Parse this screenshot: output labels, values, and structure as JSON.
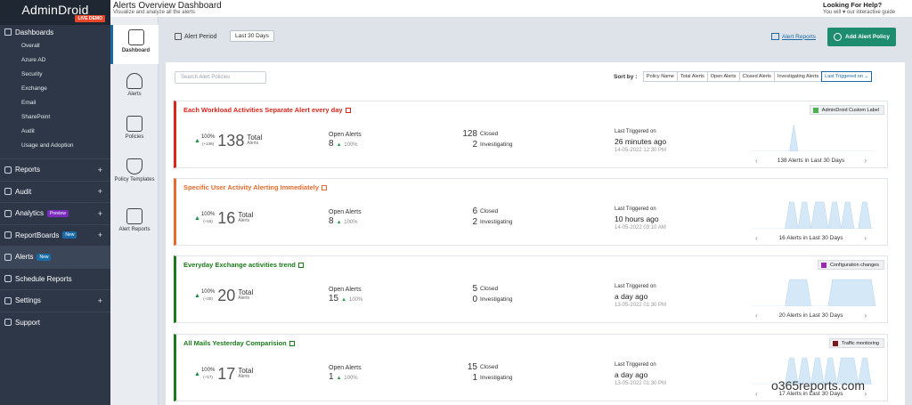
{
  "brand": {
    "name": "AdminDroid",
    "demo": "LIVE DEMO"
  },
  "nav": {
    "dashboards": "Dashboards",
    "sub_items": [
      "Overall",
      "Azure AD",
      "Security",
      "Exchange",
      "Email",
      "SharePoint",
      "Audit",
      "Usage and Adoption"
    ],
    "main_items": [
      {
        "label": "Reports",
        "plus": "+"
      },
      {
        "label": "Audit",
        "plus": "+"
      },
      {
        "label": "Analytics",
        "badge": "Preview",
        "plus": "+"
      },
      {
        "label": "ReportBoards",
        "badge": "New",
        "plus": "+"
      },
      {
        "label": "Alerts",
        "badge": "New"
      },
      {
        "label": "Schedule Reports"
      },
      {
        "label": "Settings",
        "plus": "+"
      },
      {
        "label": "Support"
      }
    ]
  },
  "col2": {
    "items": [
      "Dashboard",
      "Alerts",
      "Policies",
      "Policy Templates",
      "Alert Reports"
    ]
  },
  "header": {
    "title": "Alerts Overview Dashboard",
    "subtitle": "Visualize and analyze all the alerts",
    "help_title": "Looking For Help?",
    "help_sub": "You will ♥ our interactive guide"
  },
  "toolbar": {
    "period_label": "Alert Period",
    "period_value": "Last 30 Days",
    "alert_reports": "Alert Reports",
    "add_policy": "Add Alert Policy"
  },
  "panel": {
    "search_placeholder": "Search Alert Policies",
    "sort_label": "Sort by :",
    "sort_options": [
      "Policy Name",
      "Total Alerts",
      "Open Alerts",
      "Closed Alerts",
      "Investigating Alerts",
      "Last Triggered on ⌄"
    ]
  },
  "labels": {
    "total": "Total",
    "alerts": "Alerts",
    "open_alerts": "Open Alerts",
    "closed": "Closed",
    "investigating": "Investigating",
    "last_triggered": "Last Triggered on"
  },
  "cards": [
    {
      "title": "Each Workload Activities Separate Alert every day",
      "title_color": "#d9261c",
      "tag": "AdminDroid Custom Label",
      "tag_color": "#4caf50",
      "pct": "100%",
      "delta": "(+138)",
      "total": "138",
      "open": "8",
      "open_pct": "100%",
      "closed": "128",
      "investigating": "2",
      "last_rel": "26 minutes ago",
      "last_date": "14-05-2022 12:30 PM",
      "pager": "138 Alerts in Last 30 Days",
      "spark": [
        0,
        0,
        0,
        0,
        0,
        0,
        0,
        0,
        0,
        0,
        1,
        0,
        0,
        0,
        0,
        0,
        0,
        0,
        0,
        0,
        0,
        0,
        0,
        0,
        0,
        0,
        0,
        0,
        0,
        0
      ]
    },
    {
      "title": "Specific User Activity Alerting Immediately",
      "title_color": "#e8692b",
      "tag": "",
      "tag_color": "",
      "pct": "100%",
      "delta": "(+16)",
      "total": "16",
      "open": "8",
      "open_pct": "100%",
      "closed": "6",
      "investigating": "2",
      "last_rel": "10 hours ago",
      "last_date": "14-05-2022 03:10 AM",
      "pager": "16 Alerts in Last 30 Days",
      "spark": [
        0,
        0,
        0,
        0,
        0,
        0,
        0,
        0,
        0,
        1,
        1,
        0,
        1,
        1,
        0,
        1,
        1,
        1,
        0,
        1,
        1,
        0,
        1,
        1,
        0,
        0,
        1,
        1,
        0,
        0
      ]
    },
    {
      "title": "Everyday Exchange activities trend",
      "title_color": "#1a7a1a",
      "tag": "Configuration changes",
      "tag_color": "#9c27b0",
      "pct": "100%",
      "delta": "(+20)",
      "total": "20",
      "open": "15",
      "open_pct": "100%",
      "closed": "5",
      "investigating": "0",
      "last_rel": "a day ago",
      "last_date": "13-05-2022 01:30 PM",
      "pager": "20 Alerts in Last 30 Days",
      "spark": [
        0,
        0,
        0,
        0,
        0,
        0,
        0,
        0,
        0,
        1,
        1,
        1,
        1,
        1,
        0,
        0,
        0,
        0,
        0,
        1,
        1,
        1,
        1,
        1,
        1,
        1,
        1,
        1,
        1,
        0
      ]
    },
    {
      "title": "All Mails Yesterday Comparision",
      "title_color": "#1a7a1a",
      "tag": "Traffic monitoring",
      "tag_color": "#7a1a1a",
      "pct": "100%",
      "delta": "(+17)",
      "total": "17",
      "open": "1",
      "open_pct": "100%",
      "closed": "15",
      "investigating": "1",
      "last_rel": "a day ago",
      "last_date": "13-05-2022 01:30 PM",
      "pager": "17 Alerts in Last 30 Days",
      "spark": [
        0,
        0,
        0,
        0,
        0,
        0,
        0,
        0,
        0,
        1,
        1,
        0,
        1,
        1,
        0,
        1,
        1,
        0,
        1,
        1,
        0,
        1,
        1,
        1,
        1,
        0,
        1,
        1,
        0,
        0
      ]
    }
  ],
  "watermark": "o365reports.com"
}
